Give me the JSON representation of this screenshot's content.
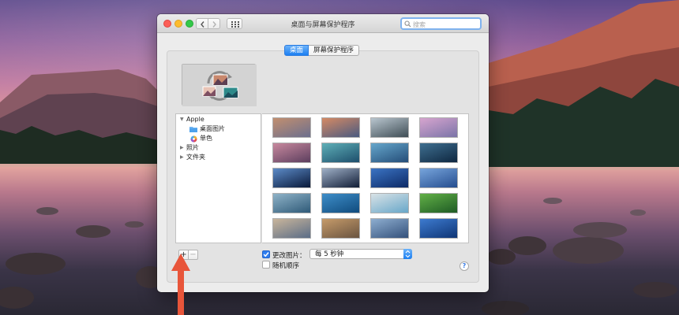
{
  "window": {
    "title": "桌面与屏幕保护程序",
    "search_placeholder": "搜索"
  },
  "tabs": [
    {
      "label": "桌面",
      "active": true
    },
    {
      "label": "屏幕保护程序",
      "active": false
    }
  ],
  "sidebar": {
    "items": [
      {
        "label": "Apple",
        "level": 0,
        "expanded": true,
        "icon": "disclosure-open"
      },
      {
        "label": "桌面图片",
        "level": 1,
        "icon": "folder-icon",
        "selected": false
      },
      {
        "label": "单色",
        "level": 1,
        "icon": "color-wheel-icon",
        "selected": false
      },
      {
        "label": "照片",
        "level": 0,
        "expanded": false,
        "icon": "disclosure-closed"
      },
      {
        "label": "文件夹",
        "level": 0,
        "expanded": false,
        "icon": "disclosure-closed"
      }
    ]
  },
  "controls": {
    "add_label": "+",
    "remove_label": "−",
    "change_picture_label": "更改图片：",
    "change_picture_checked": true,
    "interval_value": "每 5 秒钟",
    "random_order_label": "随机顺序",
    "random_order_checked": false,
    "help_label": "?"
  },
  "thumbnails": [
    {
      "name": "yosemite-1",
      "colors": [
        "#c28f6f",
        "#6c6f8e"
      ]
    },
    {
      "name": "el-capitan",
      "colors": [
        "#d58a64",
        "#4a5a80"
      ]
    },
    {
      "name": "half-dome-clouds",
      "colors": [
        "#b9c6cf",
        "#3f4d55"
      ]
    },
    {
      "name": "mountain-pink",
      "colors": [
        "#d7a5cf",
        "#7b74a8"
      ]
    },
    {
      "name": "pink-valley",
      "colors": [
        "#c8899e",
        "#5c3e5e"
      ]
    },
    {
      "name": "teal-wave",
      "colors": [
        "#5fb0b8",
        "#1d4e6b"
      ]
    },
    {
      "name": "wave-blue",
      "colors": [
        "#66a7cc",
        "#244d78"
      ]
    },
    {
      "name": "mavericks-wave",
      "colors": [
        "#3f6f90",
        "#0e2740"
      ]
    },
    {
      "name": "earth-horizon",
      "colors": [
        "#5c8bc8",
        "#0a1a3a"
      ]
    },
    {
      "name": "earth-space",
      "colors": [
        "#9fb0c7",
        "#111d36"
      ]
    },
    {
      "name": "blue-ridge",
      "colors": [
        "#3b74c4",
        "#0d2a66"
      ]
    },
    {
      "name": "blue-ice",
      "colors": [
        "#77a5dc",
        "#254d8f"
      ]
    },
    {
      "name": "frost",
      "colors": [
        "#8fb3c8",
        "#2f5a78"
      ]
    },
    {
      "name": "ocean-ripple",
      "colors": [
        "#3e8ec9",
        "#104b7d"
      ]
    },
    {
      "name": "beach",
      "colors": [
        "#d9e2e6",
        "#68a7c9"
      ]
    },
    {
      "name": "green-field",
      "colors": [
        "#62b047",
        "#1e5b24"
      ]
    },
    {
      "name": "sand-dune",
      "colors": [
        "#c9b59b",
        "#5b6d87"
      ]
    },
    {
      "name": "desert",
      "colors": [
        "#c69b6a",
        "#6a5440"
      ]
    },
    {
      "name": "misty-mountains",
      "colors": [
        "#8eaed0",
        "#34517b"
      ]
    },
    {
      "name": "lake-blue",
      "colors": [
        "#3d7bd0",
        "#0f3575"
      ]
    }
  ],
  "colors": {
    "accent": "#1c7ff1",
    "annotation_arrow": "#e8553a"
  }
}
